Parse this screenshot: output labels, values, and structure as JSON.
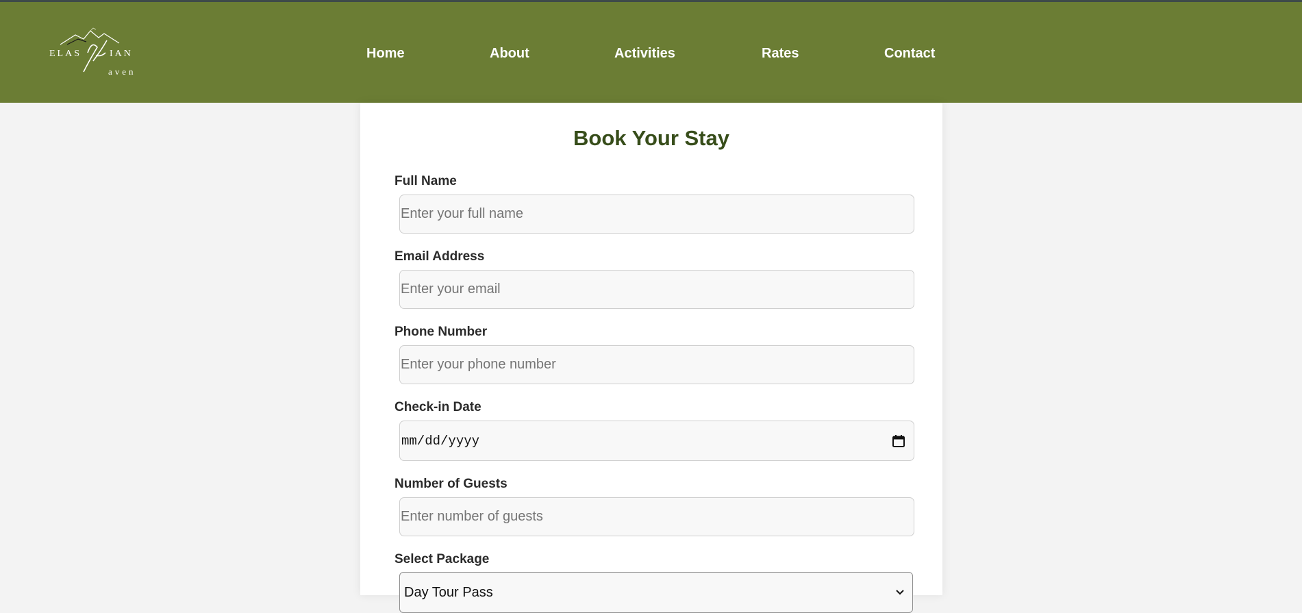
{
  "header": {
    "logo_alt": "Elasian Haven",
    "nav": [
      "Home",
      "About",
      "Activities",
      "Rates",
      "Contact"
    ]
  },
  "form": {
    "title": "Book Your Stay",
    "full_name": {
      "label": "Full Name",
      "placeholder": "Enter your full name"
    },
    "email": {
      "label": "Email Address",
      "placeholder": "Enter your email"
    },
    "phone": {
      "label": "Phone Number",
      "placeholder": "Enter your phone number"
    },
    "checkin": {
      "label": "Check-in Date",
      "placeholder": "mm/dd/yyyy"
    },
    "guests": {
      "label": "Number of Guests",
      "placeholder": "Enter number of guests"
    },
    "package": {
      "label": "Select Package",
      "selected": "Day Tour Pass"
    }
  },
  "colors": {
    "header_bg": "#6b7d34",
    "title": "#374d1a",
    "page_bg": "#f3f3f3"
  },
  "icons": [
    "mountain-logo-icon",
    "calendar-icon",
    "chevron-down-icon"
  ]
}
